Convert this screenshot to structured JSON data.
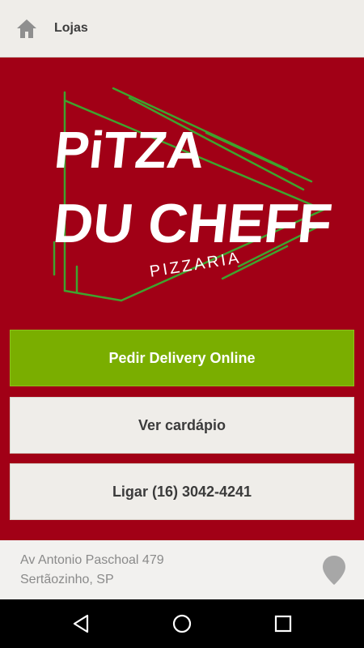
{
  "topbar": {
    "title": "Lojas",
    "home_icon": "home-icon"
  },
  "logo": {
    "line1": "PiTZA",
    "line2": "DU CHEFF",
    "line3": "PIZZARIA"
  },
  "buttons": {
    "delivery_label": "Pedir Delivery Online",
    "menu_label": "Ver cardápio",
    "call_label": "Ligar (16) 3042-4241"
  },
  "footer": {
    "address_line1": "Av Antonio Paschoal 479",
    "address_line2": "Sertãozinho, SP",
    "pin_icon": "map-pin-icon"
  },
  "navbar": {
    "icons": [
      "back-icon",
      "home-circle-icon",
      "recent-apps-icon"
    ]
  },
  "colors": {
    "brand_red": "#a10016",
    "accent_green": "#7aae00",
    "logo_green": "#3fa32e",
    "topbar_bg": "#efede9"
  }
}
